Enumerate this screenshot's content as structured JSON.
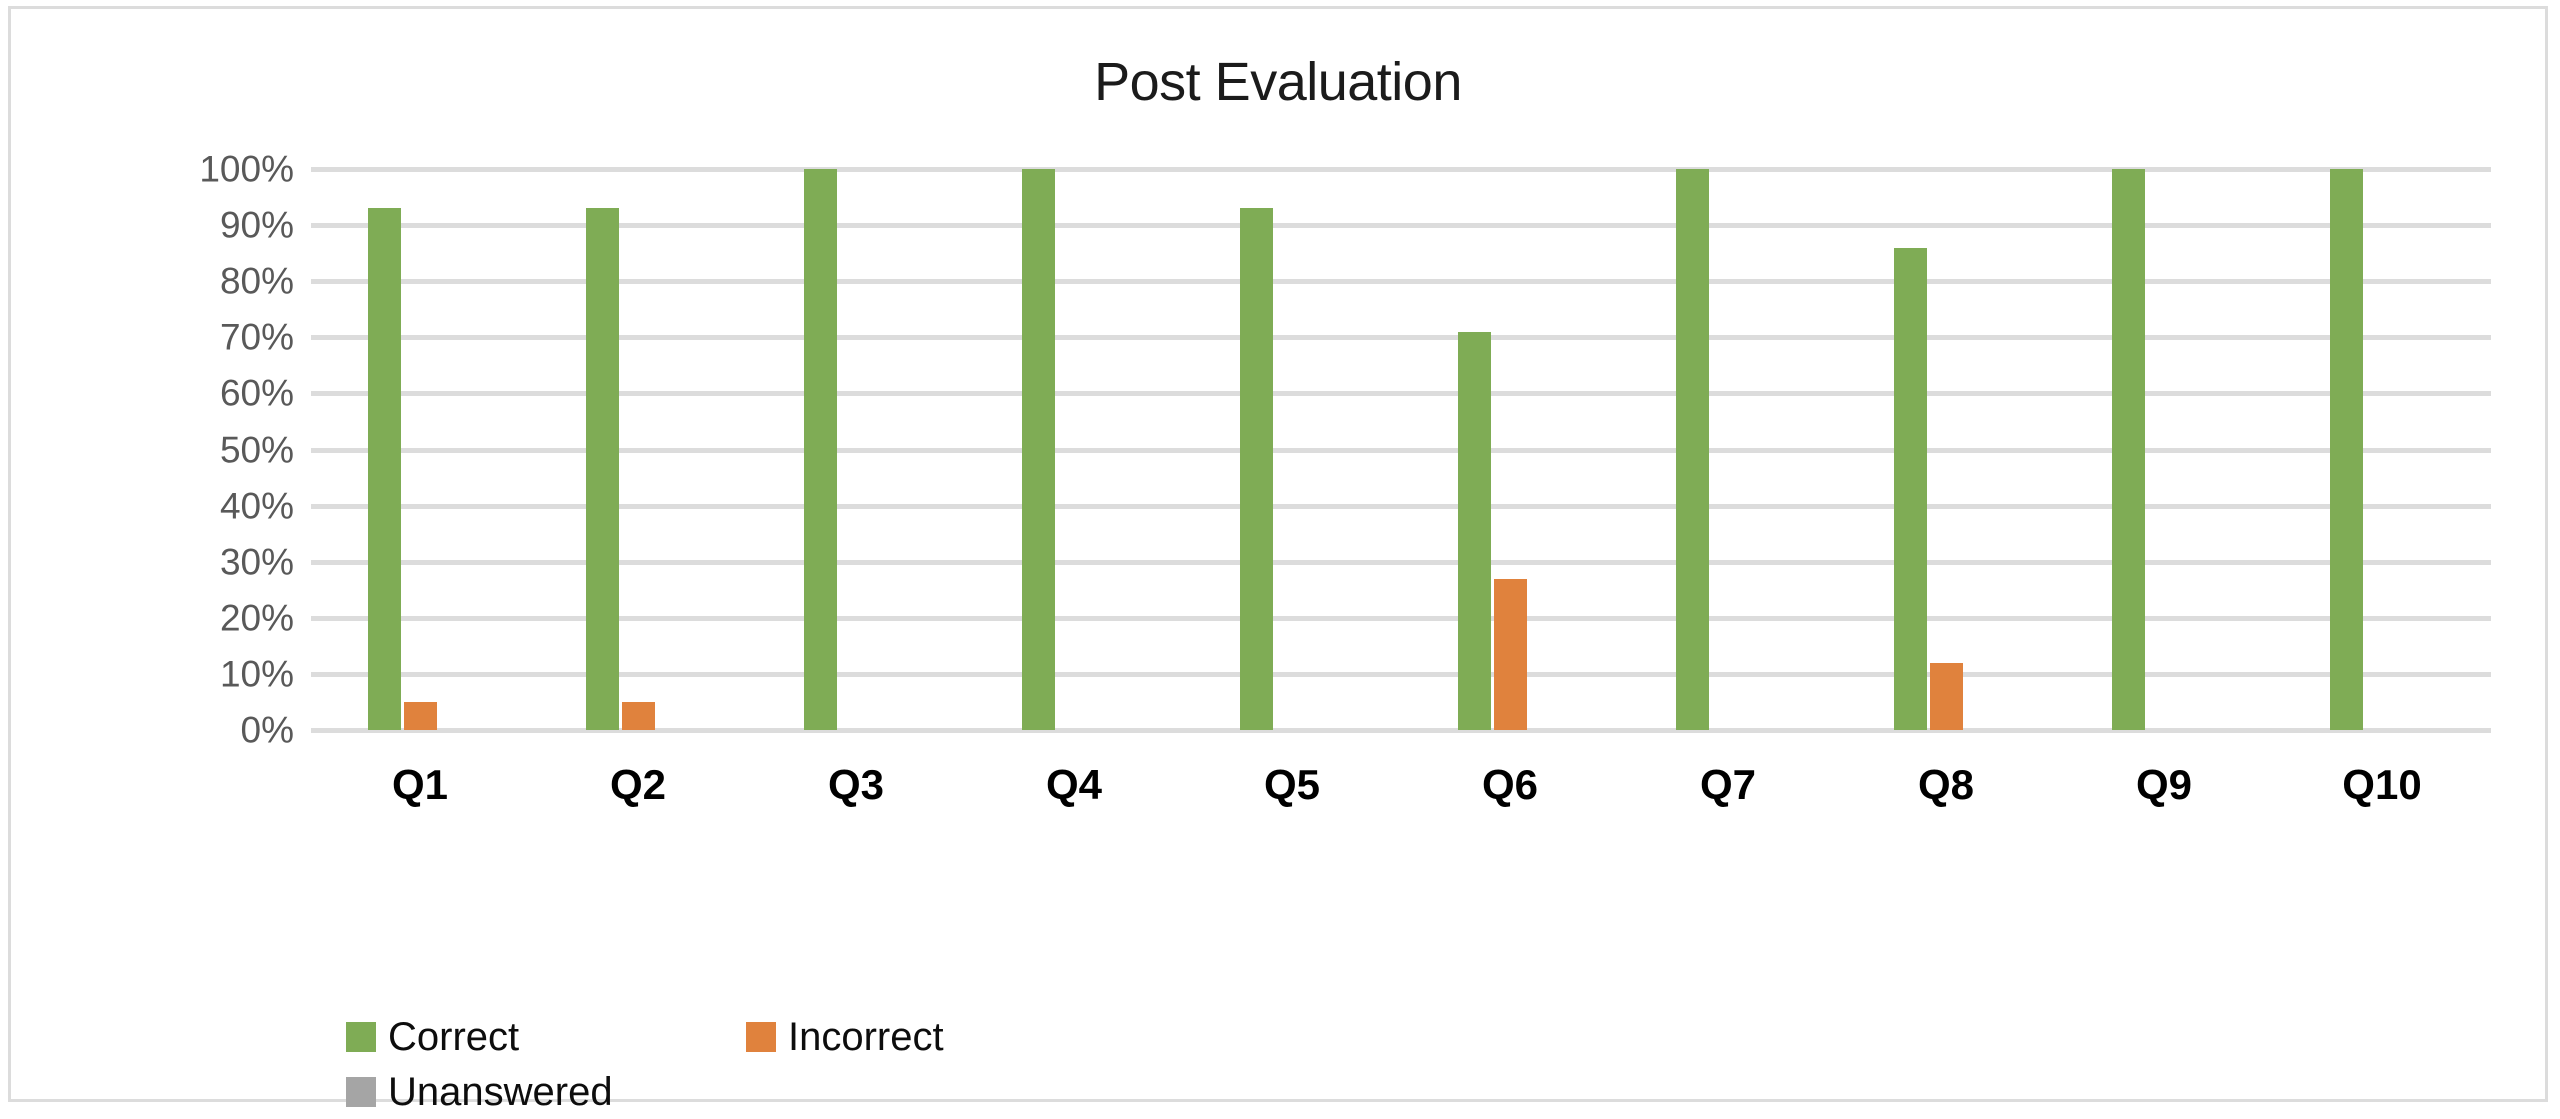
{
  "chart": {
    "title": "Post Evaluation",
    "border_color": "#dcdcdc",
    "gridline_color": "#dcdcdc",
    "background": "#ffffff"
  },
  "legend": {
    "items": [
      {
        "label": "Correct",
        "color": "#7fac55"
      },
      {
        "label": "Incorrect",
        "color": "#e0823d"
      },
      {
        "label": "Unanswered",
        "color": "#a5a5a5"
      }
    ]
  },
  "axis": {
    "y_ticks": [
      "100%",
      "90%",
      "80%",
      "70%",
      "60%",
      "50%",
      "40%",
      "30%",
      "20%",
      "10%",
      "0%"
    ],
    "x_ticks": [
      "Q1",
      "Q2",
      "Q3",
      "Q4",
      "Q5",
      "Q6",
      "Q7",
      "Q8",
      "Q9",
      "Q10"
    ]
  },
  "chart_data": {
    "type": "bar",
    "title": "Post Evaluation",
    "xlabel": "",
    "ylabel": "",
    "ylim": [
      0,
      100
    ],
    "y_tick_values": [
      0,
      10,
      20,
      30,
      40,
      50,
      60,
      70,
      80,
      90,
      100
    ],
    "y_tick_labels": [
      "0%",
      "10%",
      "20%",
      "30%",
      "40%",
      "50%",
      "60%",
      "70%",
      "80%",
      "90%",
      "100%"
    ],
    "grid": true,
    "legend_position": "bottom-left",
    "unit": "percent",
    "categories": [
      "Q1",
      "Q2",
      "Q3",
      "Q4",
      "Q5",
      "Q6",
      "Q7",
      "Q8",
      "Q9",
      "Q10"
    ],
    "series": [
      {
        "name": "Correct",
        "color": "#7fac55",
        "values": [
          93,
          93,
          100,
          100,
          93,
          71,
          100,
          86,
          100,
          100
        ]
      },
      {
        "name": "Incorrect",
        "color": "#e0823d",
        "values": [
          5,
          5,
          0,
          0,
          0,
          27,
          0,
          12,
          0,
          0
        ]
      },
      {
        "name": "Unanswered",
        "color": "#a5a5a5",
        "values": [
          0,
          0,
          0,
          0,
          0,
          0,
          0,
          0,
          0,
          0
        ]
      }
    ]
  }
}
